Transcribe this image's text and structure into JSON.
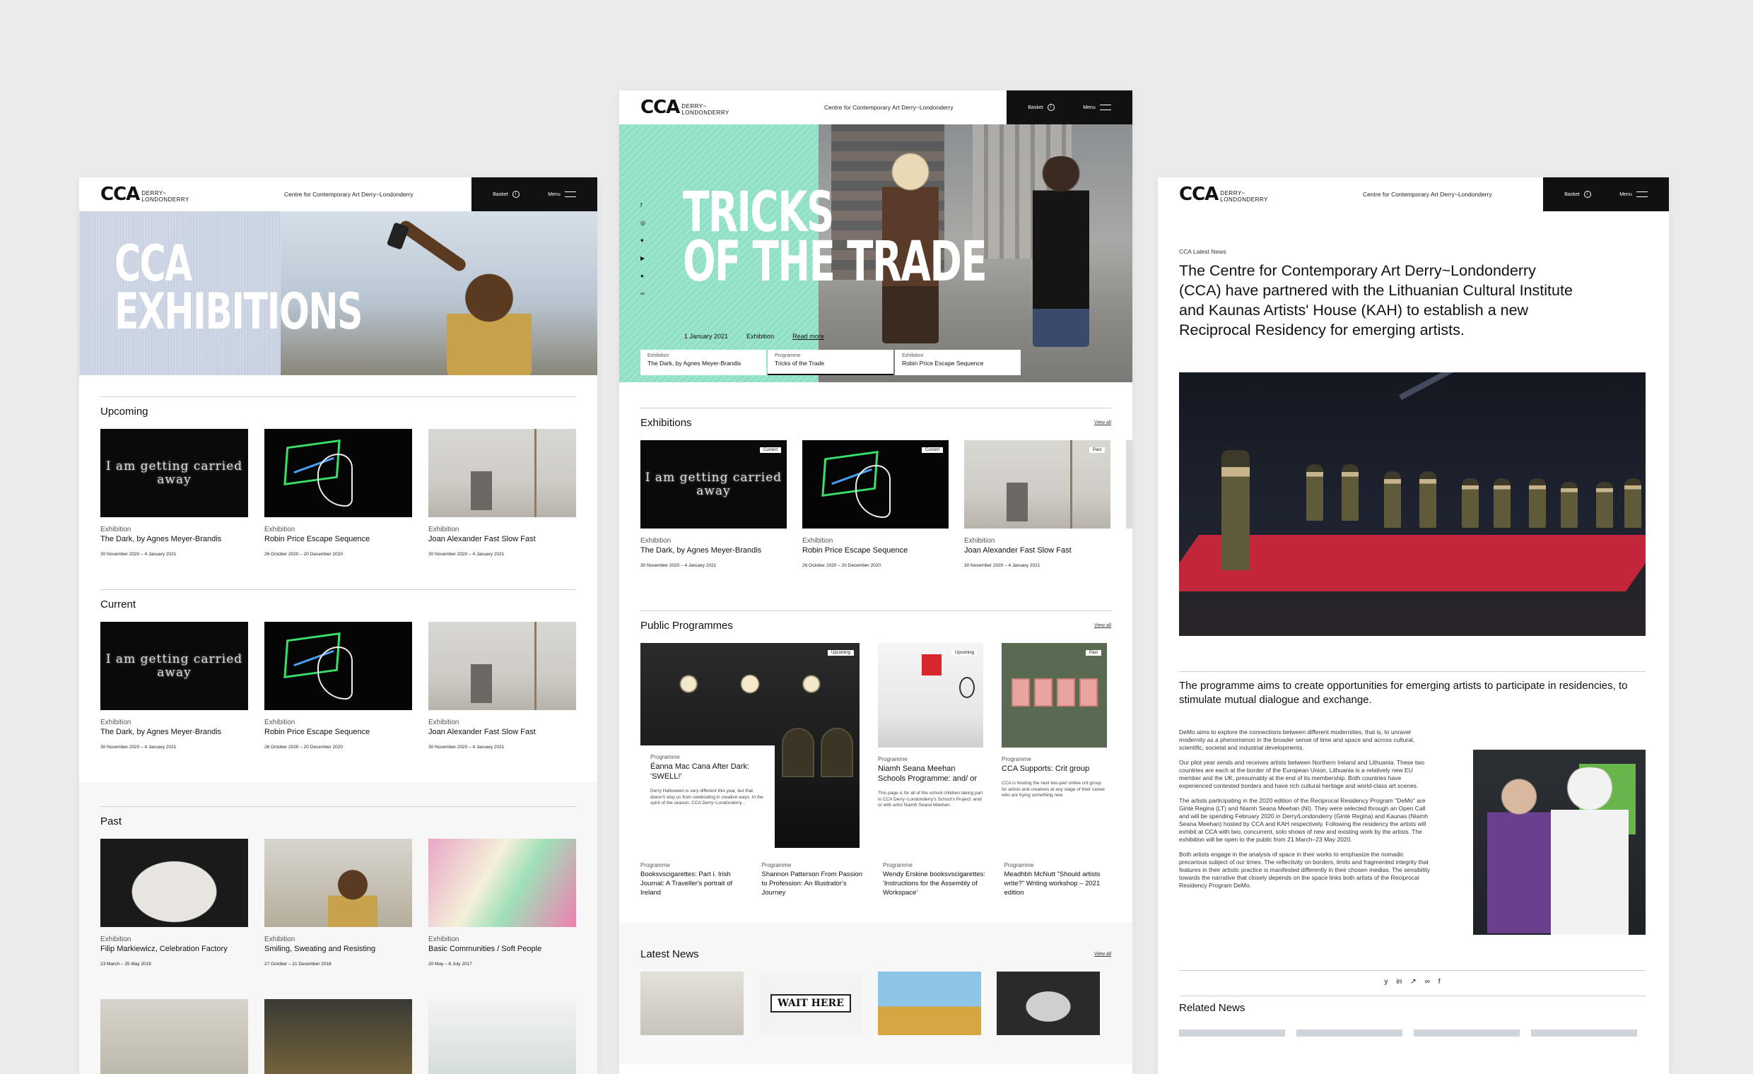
{
  "brand": {
    "mark": "CCA",
    "sub": "DERRY~ LONDONDERRY",
    "tagline": "Centre for Contemporary Art Derry~Londonderry"
  },
  "nav": {
    "basket": "Basket",
    "menu": "Menu"
  },
  "left": {
    "hero_title_1": "CCA",
    "hero_title_2": "EXHIBITIONS",
    "sections": {
      "upcoming": "Upcoming",
      "current": "Current",
      "past": "Past"
    },
    "upcoming": [
      {
        "cat": "Exhibition",
        "name": "The Dark, by Agnes Meyer-Brandis",
        "date": "30 November 2020 – 4 January 2021",
        "thumb_text": "I am getting carried away"
      },
      {
        "cat": "Exhibition",
        "name": "Robin Price Escape Sequence",
        "date": "26 October 2020 – 20 December 2020"
      },
      {
        "cat": "Exhibition",
        "name": "Joan Alexander Fast Slow Fast",
        "date": "30 November 2020 – 4 January 2021"
      }
    ],
    "current": [
      {
        "cat": "Exhibition",
        "name": "The Dark, by Agnes Meyer-Brandis",
        "date": "30 November 2020 – 4 January 2021",
        "thumb_text": "I am getting carried away"
      },
      {
        "cat": "Exhibition",
        "name": "Robin Price Escape Sequence",
        "date": "26 October 2020 – 20 December 2020"
      },
      {
        "cat": "Exhibition",
        "name": "Joan Alexander Fast Slow Fast",
        "date": "30 November 2020 – 4 January 2021"
      }
    ],
    "past": [
      {
        "cat": "Exhibition",
        "name": "Filip Markiewicz, Celebration Factory",
        "date": "23 March – 25 May 2019"
      },
      {
        "cat": "Exhibition",
        "name": "Smiling, Sweating and Resisting",
        "date": "27 October – 21 December 2018"
      },
      {
        "cat": "Exhibition",
        "name": "Basic Communities / Soft People",
        "date": "20 May – 8 July 2017"
      }
    ]
  },
  "mid": {
    "hero_title_1": "TRICKS",
    "hero_title_2": "OF THE TRADE",
    "hero_date": "1 January 2021",
    "hero_type": "Exhibition",
    "hero_link": "Read more",
    "hero_tabs": [
      {
        "k": "Exhibition",
        "v": "The Dark, by Agnes Meyer-Brandis"
      },
      {
        "k": "Programme",
        "v": "Tricks of the Trade"
      },
      {
        "k": "Exhibition",
        "v": "Robin Price Escape Sequence"
      }
    ],
    "exhibitions_title": "Exhibitions",
    "view_all": "View all",
    "exhibitions": [
      {
        "cat": "Exhibition",
        "name": "The Dark, by Agnes Meyer-Brandis",
        "date": "30 November 2020 – 4 January 2021",
        "badge": "Current",
        "thumb_text": "I am getting carried away"
      },
      {
        "cat": "Exhibition",
        "name": "Robin Price Escape Sequence",
        "date": "26 October 2020 – 20 December 2020",
        "badge": "Current"
      },
      {
        "cat": "Exhibition",
        "name": "Joan Alexander Fast Slow Fast",
        "date": "30 November 2020 – 4 January 2021",
        "badge": "Past"
      }
    ],
    "programmes_title": "Public Programmes",
    "programmes": [
      {
        "cat": "Programme",
        "name": "Éanna Mac Cana After Dark: 'SWELL!'",
        "badge": "Upcoming",
        "desc": "Derry Halloween is very different this year, but that doesn't stop us from celebrating in creative ways. In the spirit of the season, CCA Derry~Londonderry..."
      },
      {
        "cat": "Programme",
        "name": "Niamh Seana Meehan Schools Programme: and/ or",
        "badge": "Upcoming",
        "desc": "This page is for all of the school children taking part in CCA Derry~Londonderry's School's Project: and/ or with artist Niamh Seana Meehan."
      },
      {
        "cat": "Programme",
        "name": "CCA Supports: Crit group",
        "badge": "Past",
        "desc": "CCA is hosting the next two-part online crit group for artists and creatives at any stage of their career who are trying something new."
      }
    ],
    "programmes_row2": [
      {
        "cat": "Programme",
        "name": "Booksvscigarettes: Part i. Irish Journal: A Traveller's portrait of Ireland"
      },
      {
        "cat": "Programme",
        "name": "Shannon Patterson From Passion to Profession: An Illustrator's Journey"
      },
      {
        "cat": "Programme",
        "name": "Wendy Erskine booksvscigarettes: 'Instructions for the Assembly of Workspace'"
      },
      {
        "cat": "Programme",
        "name": "Meadhbh McNutt \"Should artists write?\" Writing workshop – 2021 edition"
      }
    ],
    "news_title": "Latest News",
    "news_sign": "WAIT HERE"
  },
  "right": {
    "eyebrow": "CCA Latest News",
    "headline": "The Centre for Contemporary Art Derry~Londonderry (CCA) have partnered with the Lithuanian Cultural Institute and Kaunas Artists' House (KAH) to establish a new Reciprocal Residency for emerging artists.",
    "lede": "The programme aims to create opportunities for emerging artists to participate in residencies, to stimulate mutual dialogue and exchange.",
    "body": [
      "DeMo aims to explore the connections between different modernities, that is, to unravel modernity as a phenomenon in the broader sense of time and space and across cultural, scientific, societal and industrial developments.",
      "Our pilot year sends and receives artists between Northern Ireland and Lithuania. These two countries are each at the border of the European Union, Lithuania is a relatively new EU member and the UK, presumably at the end of its membership. Both countries have experienced contested borders and have rich cultural heritage and world-class art scenes.",
      "The artists participating in the 2020 edition of the Reciprocal Residency Program \"DeMo\" are Gintė Regina (LT) and Niamh Seana Meehan (NI). They were selected through an Open Call and will be spending February 2020 in Derry/Londonderry (Gintė Regina) and Kaunas (Niamh Seana Meehan) hosted by CCA and KAH respectively. Following the residency the artists will exhibit at CCA with two, concurrent, solo shows of new and existing work by the artists. The exhibition will be open to the public from 21 March–23 May 2020.",
      "Both artists engage in the analysis of space in their works to emphasize the nomadic precarious subject of our times. The reflectivity on borders, limits and fragmented integrity that features in their artistic practice is manifested differently in their chosen medias. The sensibility towards the narrative that closely depends on the space links both artists of the Reciprocal Residency Program DeMo."
    ],
    "share": [
      "y",
      "in",
      "↗",
      "∞",
      "f"
    ],
    "related": "Related News"
  }
}
